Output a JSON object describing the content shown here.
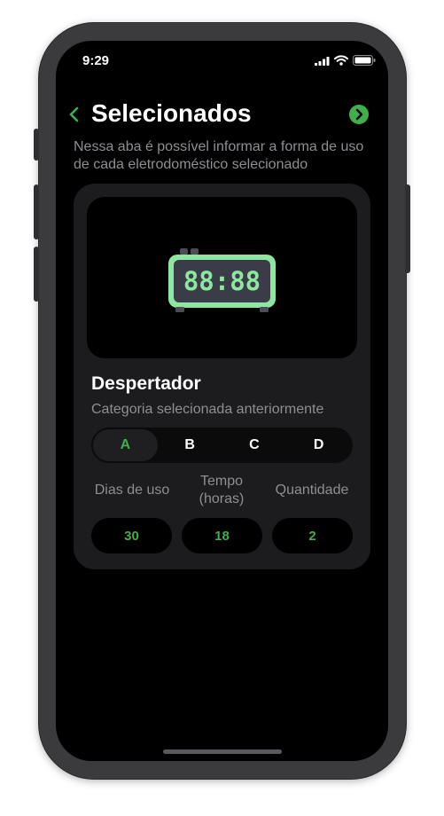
{
  "status_bar": {
    "time": "9:29",
    "icons": [
      "signal-icon",
      "wifi-icon",
      "battery-icon"
    ]
  },
  "header": {
    "back_icon": "chevron-left-icon",
    "title": "Selecionados",
    "next_icon": "chevron-right-circle-icon"
  },
  "subtitle": "Nessa aba é possível informar a forma de uso de cada eletrodoméstico selecionado",
  "card": {
    "image": {
      "icon": "digital-clock-icon",
      "clock_digits": "88:88"
    },
    "appliance_name": "Despertador",
    "category_caption": "Categoria selecionada anteriormente",
    "categories": [
      {
        "label": "A",
        "selected": true
      },
      {
        "label": "B",
        "selected": false
      },
      {
        "label": "C",
        "selected": false
      },
      {
        "label": "D",
        "selected": false
      }
    ],
    "fields": [
      {
        "label": "Dias de uso",
        "value": "30"
      },
      {
        "label": "Tempo (horas)",
        "value": "18"
      },
      {
        "label": "Quantidade",
        "value": "2"
      }
    ]
  },
  "colors": {
    "accent": "#3fae4b",
    "background": "#000000",
    "card": "#1c1c1e",
    "secondary_text": "#8e8e93",
    "clock_green": "#8ee6a0",
    "clock_screen": "#3a3d47"
  }
}
